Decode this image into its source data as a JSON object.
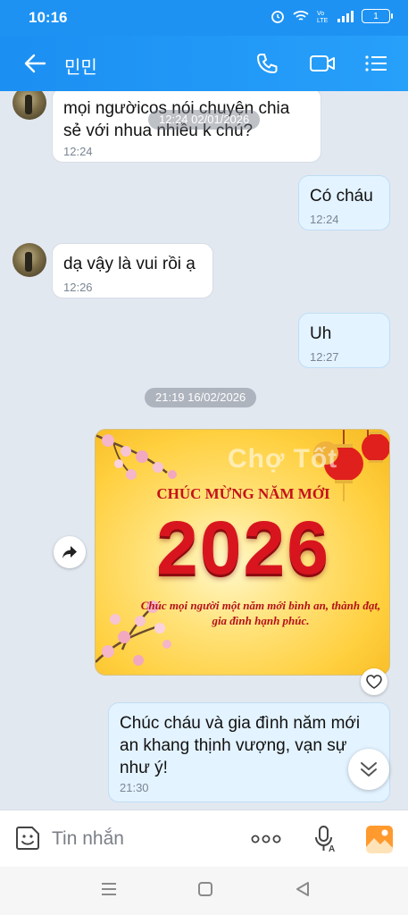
{
  "status_bar": {
    "time": "10:16",
    "battery": "1"
  },
  "header": {
    "title": "민민"
  },
  "messages": [
    {
      "text": "mọi ngườicos nói chuyện chia sẻ với nhua nhiều k chú?",
      "time": "12:24"
    },
    {
      "text": "Có cháu",
      "time": "12:24"
    },
    {
      "text": "dạ vậy là vui rồi ạ",
      "time": "12:26"
    },
    {
      "text": "Uh",
      "time": "12:27"
    },
    {
      "text": "Chúc cháu và gia đình năm mới an khang thịnh vượng, vạn sự như ý!",
      "time": "21:30"
    }
  ],
  "date_separators": [
    "12:24 02/01/2026",
    "21:19 16/02/2026"
  ],
  "image_card": {
    "banner": "CHÚC MỪNG NĂM MỚI",
    "year": "2026",
    "wish": "Chúc mọi người một năm mới bình an, thành đạt, gia đình hạnh phúc.",
    "watermark": "Chợ Tốt"
  },
  "input": {
    "placeholder": "Tin nhắn"
  },
  "colors": {
    "header": "#1d92f3",
    "outgoing_bubble": "#e3f3ff",
    "incoming_bubble": "#ffffff",
    "chat_background": "#e2e8f0"
  },
  "icons": [
    "back-icon",
    "phone-icon",
    "video-call-icon",
    "menu-list-icon",
    "share-icon",
    "heart-icon",
    "chevron-double-down-icon",
    "sticker-icon",
    "more-icon",
    "voice-icon",
    "image-icon",
    "nav-recents-icon",
    "nav-home-icon",
    "nav-back-icon"
  ]
}
